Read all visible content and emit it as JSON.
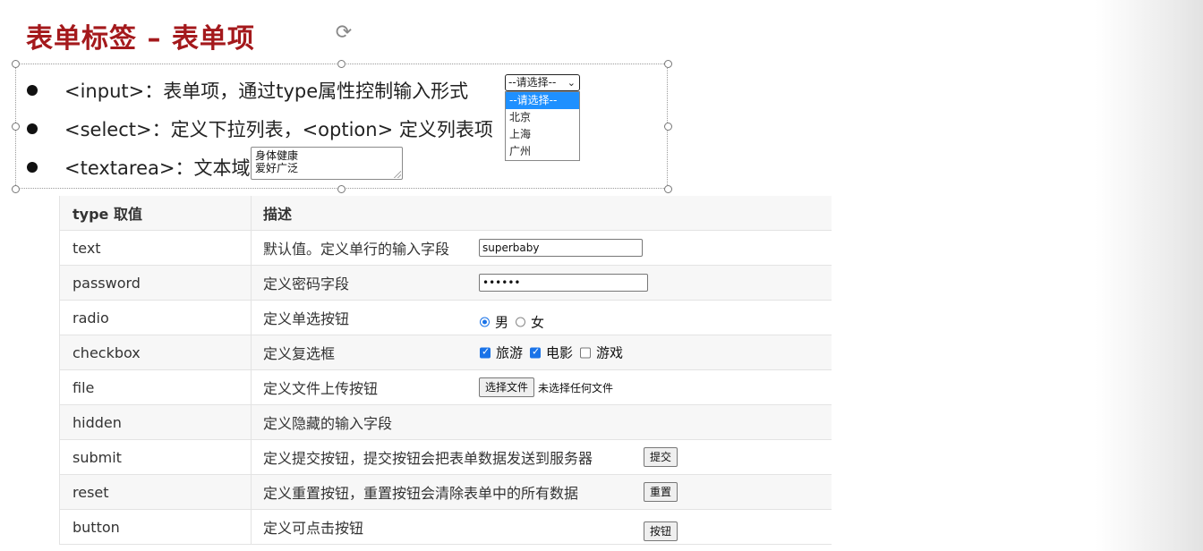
{
  "slide": {
    "title": "表单标签 – 表单项"
  },
  "bullets": [
    {
      "text": "<input>：表单项，通过type属性控制输入形式"
    },
    {
      "text": "<select>：定义下拉列表，<option> 定义列表项"
    },
    {
      "text": "<textarea>：文本域"
    }
  ],
  "textarea_demo": {
    "line1": "身体健康",
    "line2": "爱好广泛"
  },
  "select_demo": {
    "selected": "--请选择--",
    "options": [
      "--请选择--",
      "北京",
      "上海",
      "广州"
    ]
  },
  "table": {
    "headers": [
      "type 取值",
      "描述"
    ],
    "rows": [
      {
        "type": "text",
        "desc": "默认值。定义单行的输入字段"
      },
      {
        "type": "password",
        "desc": "定义密码字段"
      },
      {
        "type": "radio",
        "desc": "定义单选按钮"
      },
      {
        "type": "checkbox",
        "desc": "定义复选框"
      },
      {
        "type": "file",
        "desc": "定义文件上传按钮"
      },
      {
        "type": "hidden",
        "desc": "定义隐藏的输入字段"
      },
      {
        "type": "submit",
        "desc": "定义提交按钮，提交按钮会把表单数据发送到服务器"
      },
      {
        "type": "reset",
        "desc": "定义重置按钮，重置按钮会清除表单中的所有数据"
      },
      {
        "type": "button",
        "desc": "定义可点击按钮"
      }
    ]
  },
  "demos": {
    "text_value": "superbaby",
    "password_value": "••••••",
    "radio": [
      {
        "label": "男",
        "checked": true
      },
      {
        "label": "女",
        "checked": false
      }
    ],
    "checkbox": [
      {
        "label": "旅游",
        "checked": true
      },
      {
        "label": "电影",
        "checked": true
      },
      {
        "label": "游戏",
        "checked": false
      }
    ],
    "file_button": "选择文件",
    "file_status": "未选择任何文件",
    "submit_label": "提交",
    "reset_label": "重置",
    "button_label": "按钮"
  },
  "colors": {
    "title": "#a4191c",
    "accent": "#1a73e8"
  }
}
